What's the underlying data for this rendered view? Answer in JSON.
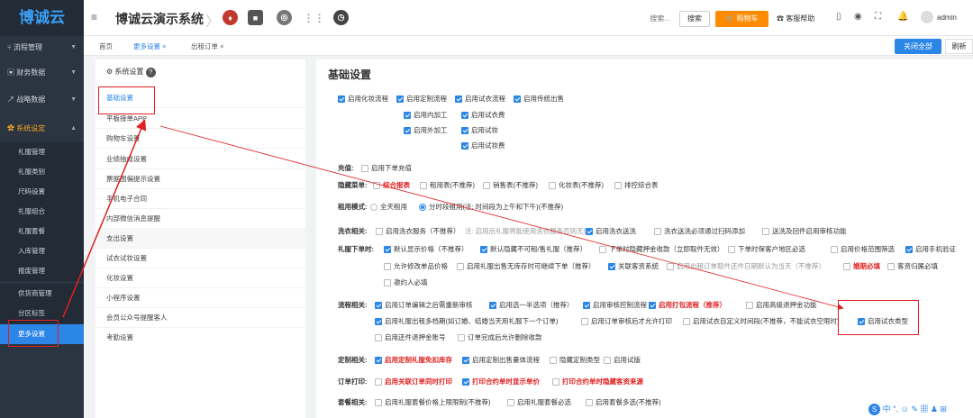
{
  "header": {
    "logo": "博诚云",
    "system_title": "博诚云演示系统",
    "search_placeholder": "搜索...",
    "search_button": "搜索",
    "cart_button": "购物车",
    "help": "客服帮助",
    "user": "admin"
  },
  "sidebar": {
    "items": [
      {
        "label": "流程管理"
      },
      {
        "label": "财务数据"
      },
      {
        "label": "战略数据"
      },
      {
        "label": "系统设定"
      }
    ],
    "sub_items": [
      {
        "label": "礼服管理"
      },
      {
        "label": "礼服类别"
      },
      {
        "label": "尺码设置"
      },
      {
        "label": "礼服组合"
      },
      {
        "label": "礼服套餐"
      },
      {
        "label": "入库管理"
      },
      {
        "label": "报废管理"
      },
      {
        "label": "供货商管理"
      },
      {
        "label": "分区标签"
      },
      {
        "label": "更多设置"
      }
    ]
  },
  "tabs": [
    {
      "label": "首页"
    },
    {
      "label": "更多设置"
    },
    {
      "label": "出租订单"
    }
  ],
  "tab_buttons": {
    "close_all": "关闭全部",
    "refresh": "刷新"
  },
  "left_panel": {
    "header": "系统设置",
    "items": [
      {
        "label": "基础设置"
      },
      {
        "label": "平板接单APP"
      },
      {
        "label": "购物车设置"
      },
      {
        "label": "业绩抽成设置"
      },
      {
        "label": "票据图偏提示设置"
      },
      {
        "label": "手机电子合同"
      },
      {
        "label": "内部微信消息提醒"
      },
      {
        "label": "支出设置"
      },
      {
        "label": "试衣试妆设置"
      },
      {
        "label": "化妆设置"
      },
      {
        "label": "小程序设置"
      },
      {
        "label": "会员公众号提醒客人"
      },
      {
        "label": "考勤设置"
      }
    ]
  },
  "main": {
    "title": "基础设置",
    "top_options": [
      {
        "label": "启用化妆流程",
        "checked": true
      },
      {
        "label": "启用定制流程",
        "checked": true
      },
      {
        "label": "启用试衣流程",
        "checked": true
      },
      {
        "label": "启用传统出售",
        "checked": true
      },
      {
        "label": "启用内加工",
        "checked": true
      },
      {
        "label": "启用试衣费",
        "checked": true
      },
      {
        "label": "启用外加工",
        "checked": true
      },
      {
        "label": "启用试妆",
        "checked": true
      },
      {
        "label": "启用试妆费",
        "checked": true
      }
    ],
    "recharge": {
      "label": "充值:",
      "options": [
        {
          "label": "启用下单充值",
          "checked": false
        }
      ]
    },
    "hidden_menu": {
      "label": "隐藏菜单:",
      "options": [
        {
          "label": "综合报表",
          "checked": false
        },
        {
          "label": "租用表(不推荐)",
          "checked": false
        },
        {
          "label": "销售表(不推荐)",
          "checked": false
        },
        {
          "label": "化妆表(不推荐)",
          "checked": false
        },
        {
          "label": "排控综合表",
          "checked": false
        }
      ]
    },
    "rent_mode": {
      "label": "租用模式:",
      "options": [
        {
          "label": "全天租用"
        },
        {
          "label": "分时段租用(注: 时间段为上午和下午)(不推荐)"
        }
      ]
    },
    "wash": {
      "label": "洗衣相关:",
      "options": [
        {
          "label": "启用洗衣服务（不推荐）",
          "checked": false
        },
        {
          "label": "注: 启用后礼服将能使用洗衣服务否则无效",
          "checked": false
        },
        {
          "label": "启用洗衣送洗",
          "checked": true
        },
        {
          "label": "洗衣送洗必须通过扫码添加",
          "checked": false
        },
        {
          "label": "送洗及回件启用审核功能",
          "checked": false
        }
      ]
    },
    "order": {
      "label": "礼服下单时:",
      "options": [
        {
          "label": "默认显示价格（不推荐）",
          "checked": true
        },
        {
          "label": "默认隐藏不可租/售礼服（推荐）",
          "checked": true
        },
        {
          "label": "下单时隐藏押金收款（立即取件无效）",
          "checked": false
        },
        {
          "label": "下单时保客户地区必选",
          "checked": false
        },
        {
          "label": "启用价格范围筛选",
          "checked": false
        },
        {
          "label": "启用手机验证",
          "checked": true
        },
        {
          "label": "允许修改单品价格",
          "checked": false
        },
        {
          "label": "启用礼服出售无库存时可继续下单（推荐）",
          "checked": false
        },
        {
          "label": "关联客资系统",
          "checked": true
        },
        {
          "label": "启用出租订单取件还件日期默认为当天（不推荐）",
          "checked": false
        },
        {
          "label": "婚期必填",
          "checked": false
        },
        {
          "label": "客资归属必填",
          "checked": false
        },
        {
          "label": "邀约人必填",
          "checked": false
        }
      ]
    },
    "flow": {
      "label": "流程相关:",
      "options": [
        {
          "label": "启用订单编辑之后需重新审核",
          "checked": true
        },
        {
          "label": "启用选一半选项（推荐）",
          "checked": true
        },
        {
          "label": "启用审核控制流程",
          "checked": true
        },
        {
          "label": "启用打包流程（推荐）",
          "checked": true
        },
        {
          "label": "启用高级退押金功能",
          "checked": false
        },
        {
          "label": "启用礼服出租多档期(如订婚、结婚当天用礼服下一个订单)",
          "checked": true
        },
        {
          "label": "启用订单审核后才允许打印",
          "checked": false
        },
        {
          "label": "启用试衣自定义时间段(不推荐，不能试衣空限时)",
          "checked": false
        },
        {
          "label": "启用试衣类型",
          "checked": true
        },
        {
          "label": "启用还件退押金账号",
          "checked": false
        },
        {
          "label": "订单完成后允许删除收款",
          "checked": false
        }
      ]
    },
    "custom": {
      "label": "定制相关:",
      "options": [
        {
          "label": "启用定制礼服免扣库存",
          "checked": true
        },
        {
          "label": "启用定制出售量体流程",
          "checked": true
        },
        {
          "label": "隐藏定制类型",
          "checked": false
        },
        {
          "label": "启用试版",
          "checked": false
        }
      ]
    },
    "print": {
      "label": "订单打印:",
      "options": [
        {
          "label": "启用关联订单同时打印",
          "checked": false
        },
        {
          "label": "打印合约单时显示单价",
          "checked": true
        },
        {
          "label": "打印合约单时隐藏客资来源",
          "checked": false
        }
      ]
    },
    "package": {
      "label": "套餐相关:",
      "options": [
        {
          "label": "启用礼服套餐价格上限限制(不推荐)",
          "checked": false
        },
        {
          "label": "启用礼服套餐必选",
          "checked": false
        },
        {
          "label": "启用套餐多选(不推荐)",
          "checked": false
        }
      ]
    }
  },
  "bottom_tray": "中"
}
